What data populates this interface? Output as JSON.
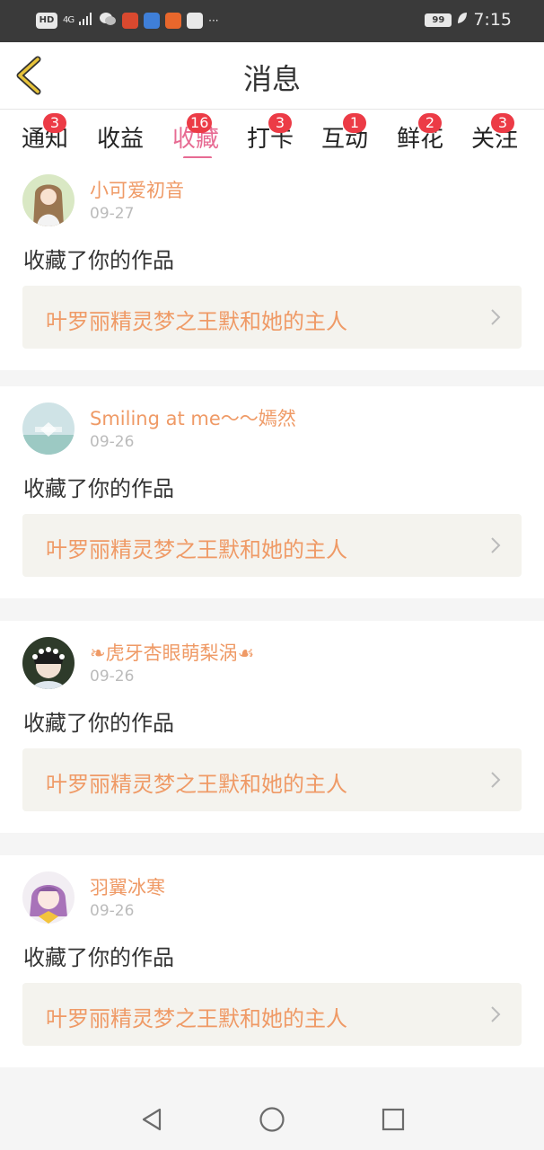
{
  "status_bar": {
    "hd": "HD",
    "network": "4G",
    "more": "···",
    "battery": "99",
    "time": "7:15",
    "icons": [
      "wechat-icon",
      "app-icon",
      "app-icon",
      "taobao-icon",
      "baidu-icon",
      "leaf-icon"
    ]
  },
  "header": {
    "title": "消息",
    "back_icon": "chevron-left-icon",
    "accent": "#e7c33a"
  },
  "tabs": [
    {
      "label": "通知",
      "badge": "3"
    },
    {
      "label": "收益",
      "badge": ""
    },
    {
      "label": "收藏",
      "badge": "16",
      "active": true
    },
    {
      "label": "打卡",
      "badge": "3"
    },
    {
      "label": "互动",
      "badge": "1"
    },
    {
      "label": "鲜花",
      "badge": "2"
    },
    {
      "label": "关注",
      "badge": "3"
    }
  ],
  "messages": [
    {
      "user": "小可爱初音",
      "date": "09-27",
      "action": "收藏了你的作品",
      "work": "叶罗丽精灵梦之王默和她的主人"
    },
    {
      "user": "Smiling at me〜〜嫣然",
      "date": "09-26",
      "action": "收藏了你的作品",
      "work": "叶罗丽精灵梦之王默和她的主人"
    },
    {
      "user": "❧虎牙杏眼萌梨涡☙",
      "date": "09-26",
      "action": "收藏了你的作品",
      "work": "叶罗丽精灵梦之王默和她的主人"
    },
    {
      "user": "羽翼冰寒",
      "date": "09-26",
      "action": "收藏了你的作品",
      "work": "叶罗丽精灵梦之王默和她的主人"
    }
  ],
  "colors": {
    "accent_pink": "#e76b93",
    "name_orange": "#ef9a66",
    "badge_red": "#ec3b46",
    "card_bg": "#f4f3ee"
  },
  "navigation": [
    "back-triangle-icon",
    "home-circle-icon",
    "recents-square-icon"
  ]
}
